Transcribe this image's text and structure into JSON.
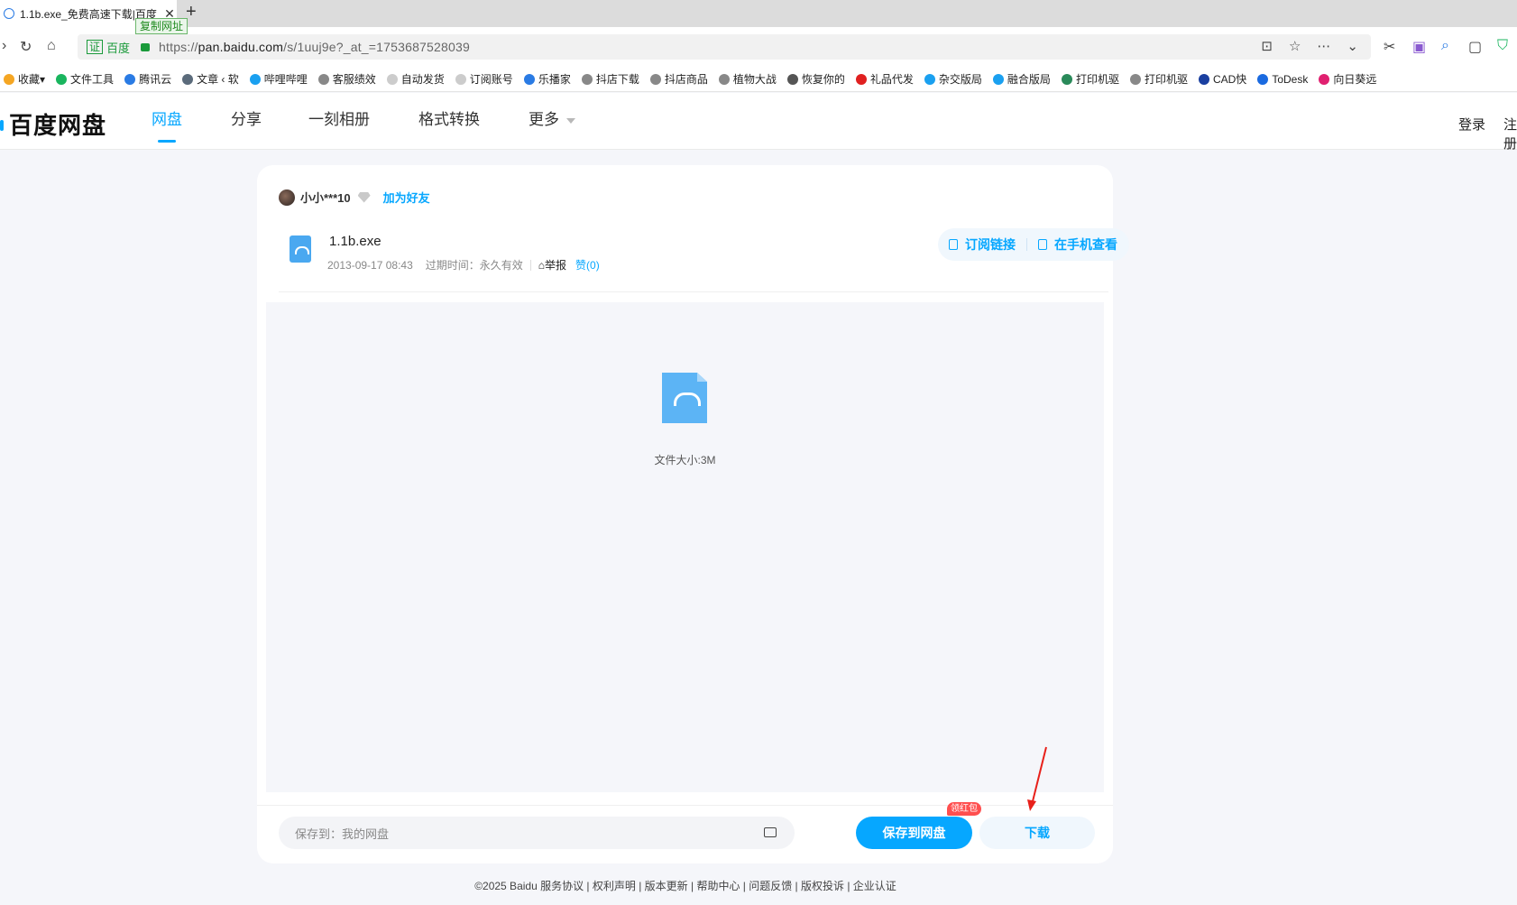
{
  "browser": {
    "tab_title": "1.1b.exe_免费高速下载|百度",
    "copy_tip": "复制网址",
    "site_name": "百度",
    "url_prefix": "https://",
    "url_host": "pan.baidu.com",
    "url_path": "/s/1uuj9e?_at_=1753687528039"
  },
  "bookmarks": [
    {
      "label": "收藏",
      "color": "#f5a623"
    },
    {
      "label": "文件工具",
      "color": "#19b55e"
    },
    {
      "label": "腾讯云",
      "color": "#2a7be4"
    },
    {
      "label": "文章 ‹ 软",
      "color": "#5b6b7b"
    },
    {
      "label": "哔哩哔哩",
      "color": "#1aa0f0"
    },
    {
      "label": "客服绩效",
      "color": "#888888"
    },
    {
      "label": "自动发货",
      "color": "#cccccc"
    },
    {
      "label": "订阅账号",
      "color": "#cccccc"
    },
    {
      "label": "乐播家",
      "color": "#2a7be4"
    },
    {
      "label": "抖店下载",
      "color": "#888888"
    },
    {
      "label": "抖店商品",
      "color": "#888888"
    },
    {
      "label": "植物大战",
      "color": "#888888"
    },
    {
      "label": "恢复你的",
      "color": "#555555"
    },
    {
      "label": "礼品代发",
      "color": "#e02020"
    },
    {
      "label": "杂交版局",
      "color": "#1aa0f0"
    },
    {
      "label": "融合版局",
      "color": "#1aa0f0"
    },
    {
      "label": "打印机驱",
      "color": "#2a8a5a"
    },
    {
      "label": "打印机驱",
      "color": "#888888"
    },
    {
      "label": "CAD快",
      "color": "#1a3fa0"
    },
    {
      "label": "ToDesk",
      "color": "#1a6ae0"
    },
    {
      "label": "向日葵远",
      "color": "#e02070"
    }
  ],
  "header": {
    "logo": "百度网盘",
    "nav": [
      "网盘",
      "分享",
      "一刻相册",
      "格式转换",
      "更多"
    ],
    "login": "登录",
    "register": "注册"
  },
  "share": {
    "sharer_name": "小小***10",
    "add_friend": "加为好友",
    "file_name": "1.1b.exe",
    "date": "2013-09-17 08:43",
    "expire": "过期时间：永久有效",
    "report": "举报",
    "likes": "赞(0)",
    "subscribe": "订阅链接",
    "view_mobile": "在手机查看",
    "file_size": "文件大小:3M",
    "save_to_placeholder": "保存到：我的网盘",
    "save_button": "保存到网盘",
    "redpack_badge": "领红包",
    "download_button": "下载"
  },
  "footer": "©2025 Baidu  服务协议 | 权利声明 | 版本更新 | 帮助中心 | 问题反馈 | 版权投诉 | 企业认证",
  "colors": {
    "accent": "#06a7ff",
    "annotation_arrow": "#e8201a"
  }
}
